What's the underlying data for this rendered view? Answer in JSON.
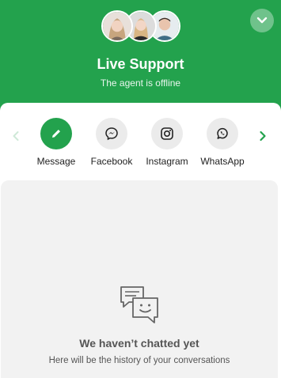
{
  "header": {
    "title": "Live Support",
    "status": "The agent is offline",
    "background_color": "#23a24d"
  },
  "avatars": [
    "agent-avatar-1",
    "agent-avatar-2",
    "agent-avatar-3"
  ],
  "channels": [
    {
      "label": "Message",
      "icon": "pencil-icon",
      "active": true
    },
    {
      "label": "Facebook",
      "icon": "messenger-icon",
      "active": false
    },
    {
      "label": "Instagram",
      "icon": "instagram-icon",
      "active": false
    },
    {
      "label": "WhatsApp",
      "icon": "whatsapp-icon",
      "active": false
    }
  ],
  "history": {
    "empty_title": "We haven’t chatted yet",
    "empty_subtitle": "Here will be the history of your conversations"
  }
}
